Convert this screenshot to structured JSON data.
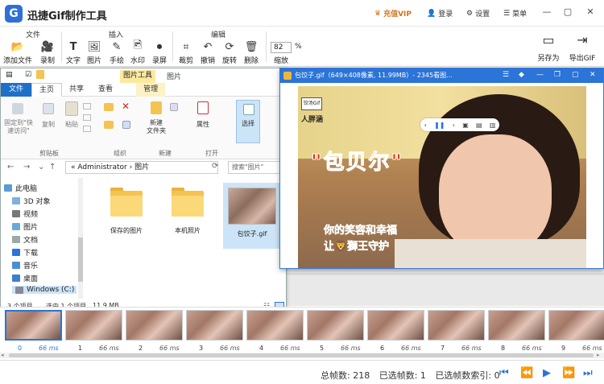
{
  "app": {
    "title": "迅捷Gif制作工具",
    "logo_glyph": "G",
    "vip": "充值VIP",
    "login": "登录",
    "settings": "设置",
    "menu": "菜单"
  },
  "ribbon": {
    "groups": {
      "file": "文件",
      "insert": "插入",
      "edit": "编辑"
    },
    "tools": {
      "add_file": "添加文件",
      "record": "录制",
      "text": "文字",
      "image": "图片",
      "handdraw": "手绘",
      "watermark": "水印",
      "recordscreen": "录屏",
      "crop": "裁剪",
      "undo": "撤销",
      "rotate": "旋转",
      "delete": "删除",
      "save_as": "另存为",
      "export_gif": "导出GIF"
    },
    "zoom": {
      "value": "82",
      "pct": "%",
      "label": "缩放"
    }
  },
  "explorer": {
    "window_title": "图片",
    "ctx_tab": "图片工具",
    "tabs": [
      "文件",
      "主页",
      "共享",
      "查看",
      "管理"
    ],
    "ribbon": {
      "pin": "固定到\"快\n速访问\"",
      "copy": "复制",
      "paste": "粘贴",
      "new_folder": "新建\n文件夹",
      "properties": "属性",
      "select": "选择",
      "groups": {
        "clipboard": "剪贴板",
        "organize": "组织",
        "new": "新建",
        "open": "打开"
      }
    },
    "address": {
      "prefix": "«",
      "path": "Administrator  ›  图片",
      "search": "搜索\"图片\""
    },
    "nav": [
      "此电脑",
      "3D 对象",
      "视频",
      "图片",
      "文档",
      "下载",
      "音乐",
      "桌面",
      "Windows (C:)"
    ],
    "files": [
      {
        "name": "保存的图片"
      },
      {
        "name": "本机照片"
      },
      {
        "name": "包饺子.gif"
      }
    ],
    "status": {
      "items": "3 个项目",
      "selected": "选中 1 个项目",
      "size": "11.9 MB"
    }
  },
  "viewer": {
    "title": "包饺子.gif（649×408像素, 11.99MB）- 2345看图...",
    "chip_logo": "饺汤Gif",
    "chip_text": "人胖涵",
    "red_caption": "\"包贝尔\"",
    "green_line1": "你的笑容和幸福",
    "green_line2": "让🦁獅王守护"
  },
  "frames": [
    {
      "num": "0",
      "ms": "66 ms"
    },
    {
      "num": "1",
      "ms": "66 ms"
    },
    {
      "num": "2",
      "ms": "66 ms"
    },
    {
      "num": "3",
      "ms": "66 ms"
    },
    {
      "num": "4",
      "ms": "66 ms"
    },
    {
      "num": "5",
      "ms": "66 ms"
    },
    {
      "num": "6",
      "ms": "66 ms"
    },
    {
      "num": "7",
      "ms": "66 ms"
    },
    {
      "num": "8",
      "ms": "66 ms"
    },
    {
      "num": "9",
      "ms": "66 ms"
    }
  ],
  "status": {
    "total": "总帧数: 218",
    "selected": "已选帧数: 1",
    "index": "已选帧数索引: 0"
  },
  "colors": {
    "accent": "#2b74d8",
    "vip": "#d4731a",
    "folder": "#f4c351"
  }
}
